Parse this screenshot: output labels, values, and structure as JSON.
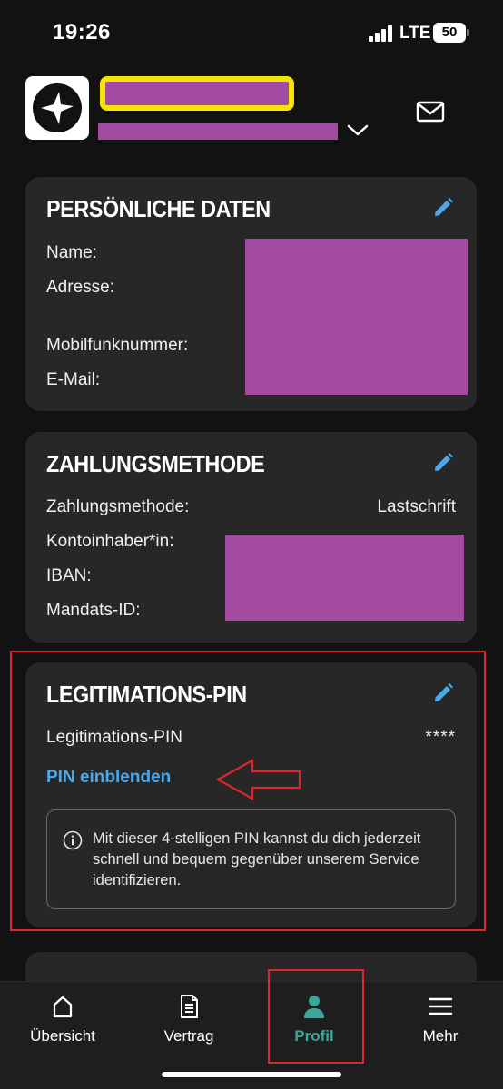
{
  "status_bar": {
    "time": "19:26",
    "network": "LTE",
    "battery": "50"
  },
  "personal": {
    "title": "PERSÖNLICHE DATEN",
    "labels": {
      "name": "Name:",
      "address": "Adresse:",
      "mobile": "Mobilfunknummer:",
      "email": "E-Mail:"
    }
  },
  "payment": {
    "title": "ZAHLUNGSMETHODE",
    "labels": {
      "method": "Zahlungsmethode:",
      "holder": "Kontoinhaber*in:",
      "iban": "IBAN:",
      "mandate": "Mandats-ID:"
    },
    "method_value": "Lastschrift"
  },
  "pin": {
    "title": "LEGITIMATIONS-PIN",
    "label": "Legitimations-PIN",
    "value": "****",
    "reveal_link": "PIN einblenden",
    "info": "Mit dieser 4-stelligen PIN kannst du dich jederzeit schnell und bequem gegenüber unserem Service identifizieren."
  },
  "nav": [
    {
      "label": "Übersicht",
      "icon": "home-icon",
      "active": false
    },
    {
      "label": "Vertrag",
      "icon": "document-icon",
      "active": false
    },
    {
      "label": "Profil",
      "icon": "person-icon",
      "active": true
    },
    {
      "label": "Mehr",
      "icon": "menu-icon",
      "active": false
    }
  ],
  "colors": {
    "background": "#121212",
    "card": "#272727",
    "accent_blue": "#4aa8ec",
    "accent_teal": "#3aa79a",
    "redaction": "#a24ba0",
    "highlight_yellow": "#f6e400",
    "annotation_red": "#e0262c"
  }
}
